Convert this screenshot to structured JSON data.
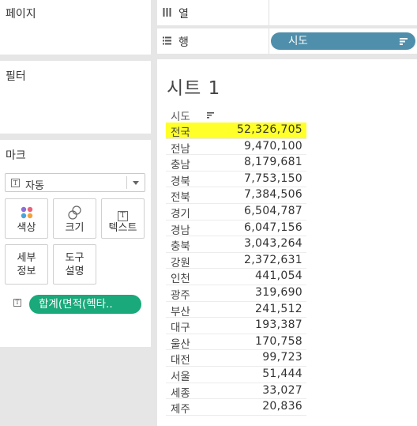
{
  "pages_panel": {
    "title": "페이지"
  },
  "filters_panel": {
    "title": "필터"
  },
  "marks_panel": {
    "title": "마크",
    "mark_type": "자동",
    "buttons": {
      "color": "색상",
      "size": "크기",
      "text": "텍스트",
      "detail_line1": "세부",
      "detail_line2": "정보",
      "tooltip_line1": "도구",
      "tooltip_line2": "설명"
    },
    "text_pill": "합계(면적(헥타.."
  },
  "columns_shelf": {
    "label": "열"
  },
  "rows_shelf": {
    "label": "행",
    "pill": "시도"
  },
  "sheet": {
    "title": "시트 1",
    "column_header": "시도",
    "rows": [
      {
        "name": "전국",
        "value": "52,326,705"
      },
      {
        "name": "전남",
        "value": "9,470,100"
      },
      {
        "name": "충남",
        "value": "8,179,681"
      },
      {
        "name": "경북",
        "value": "7,753,150"
      },
      {
        "name": "전북",
        "value": "7,384,506"
      },
      {
        "name": "경기",
        "value": "6,504,787"
      },
      {
        "name": "경남",
        "value": "6,047,156"
      },
      {
        "name": "충북",
        "value": "3,043,264"
      },
      {
        "name": "강원",
        "value": "2,372,631"
      },
      {
        "name": "인천",
        "value": "441,054"
      },
      {
        "name": "광주",
        "value": "319,690"
      },
      {
        "name": "부산",
        "value": "241,512"
      },
      {
        "name": "대구",
        "value": "193,387"
      },
      {
        "name": "울산",
        "value": "170,758"
      },
      {
        "name": "대전",
        "value": "99,723"
      },
      {
        "name": "서울",
        "value": "51,444"
      },
      {
        "name": "세종",
        "value": "33,027"
      },
      {
        "name": "제주",
        "value": "20,836"
      }
    ]
  },
  "colors": {
    "highlight": "#ffff2a",
    "rows_pill": "#4f8fab",
    "marks_pill": "#19a97a"
  }
}
